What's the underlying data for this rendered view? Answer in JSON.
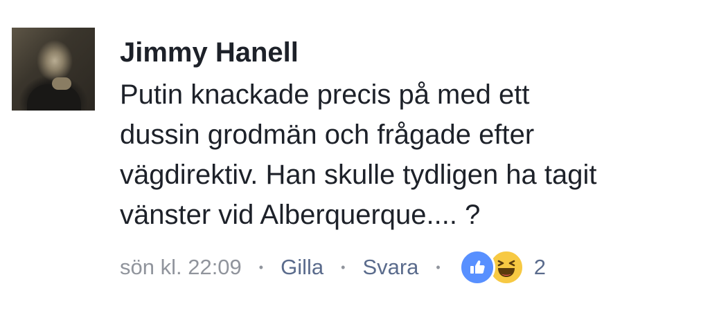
{
  "comment": {
    "author": "Jimmy Hanell",
    "text_lines": [
      "Putin knackade precis på med ett",
      "dussin grodmän och frågade efter",
      "vägdirektiv. Han skulle tydligen ha tagit",
      "vänster vid Alberquerque.... ?"
    ],
    "timestamp": "sön kl. 22:09",
    "separator": "•",
    "like_label": "Gilla",
    "reply_label": "Svara",
    "reaction_count": "2",
    "reactions": [
      "like-icon",
      "haha-icon"
    ]
  },
  "colors": {
    "text": "#1d2129",
    "meta_gray": "#90949c",
    "action_blue": "#5a6b8c",
    "like_blue": "#5890ff",
    "haha_yellow": "#f7c943"
  }
}
